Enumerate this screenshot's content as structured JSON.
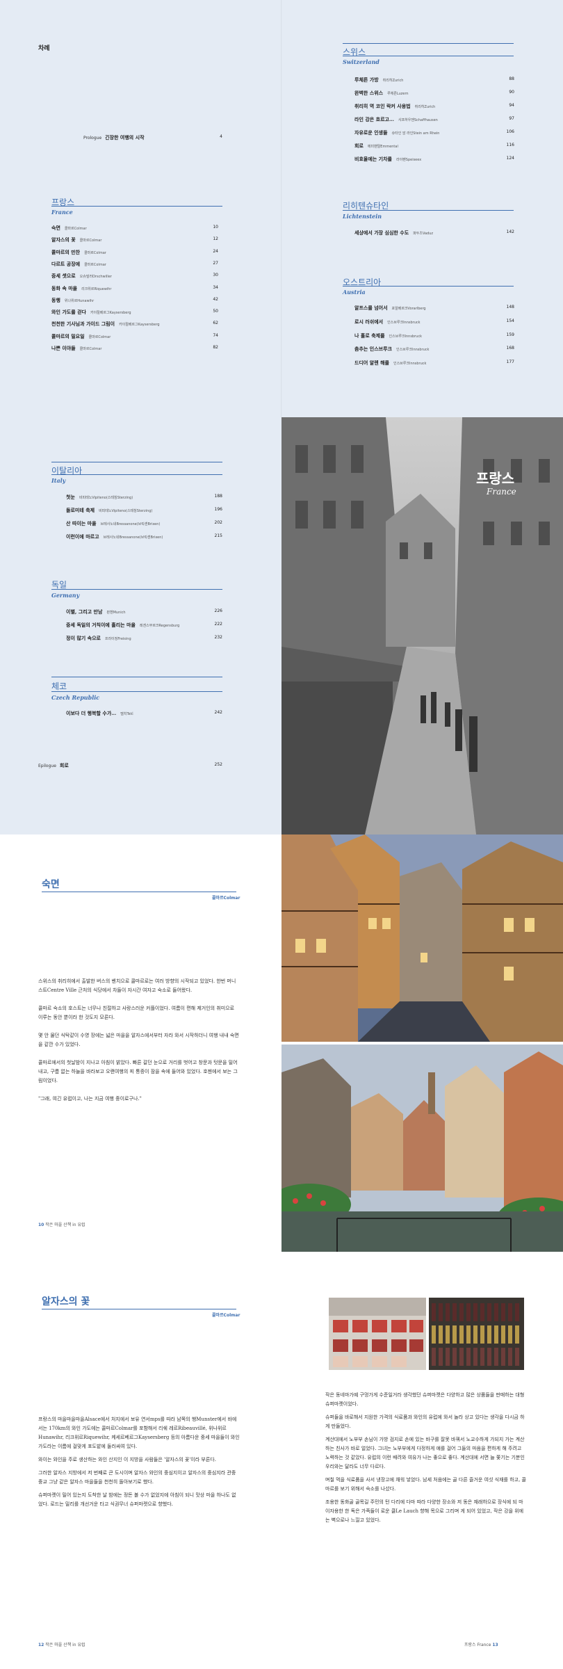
{
  "toc": {
    "label": "차례",
    "prologue": {
      "kind": "Prologue",
      "title": "긴장한 여행의 시작",
      "page": "4"
    },
    "epilogue": {
      "kind": "Epilogue",
      "title": "회로",
      "page": "252"
    },
    "france": {
      "ko": "프랑스",
      "en": "France",
      "entries": [
        {
          "t": "숙면",
          "p": "콜마르Colmar",
          "n": "10"
        },
        {
          "t": "알자스의 꽃",
          "p": "콜마르Colmar",
          "n": "12"
        },
        {
          "t": "콜마르의 만찬",
          "p": "콜마르Colmar",
          "n": "24"
        },
        {
          "t": "다르트 공장에",
          "p": "콜마르Colmar",
          "n": "27"
        },
        {
          "t": "중세 셋으로",
          "p": "오슈빌러Orschwiller",
          "n": "30"
        },
        {
          "t": "동화 속 마을",
          "p": "리크위르Riquewihr",
          "n": "34"
        },
        {
          "t": "동행",
          "p": "위나위르Hunawihr",
          "n": "42"
        },
        {
          "t": "와인 가도를 걷다",
          "p": "카이절베르그Kaysersberg",
          "n": "50"
        },
        {
          "t": "천천한 기사님과 가이드 그림이",
          "p": "카이절베르그Kaysersberg",
          "n": "62"
        },
        {
          "t": "콜마르의 밀요일",
          "p": "콜마르Colmar",
          "n": "74"
        },
        {
          "t": "나쁜 이야들",
          "p": "콜마르Colmar",
          "n": "82"
        }
      ]
    },
    "switzerland": {
      "ko": "스위스",
      "en": "Switzerland",
      "entries": [
        {
          "t": "루체른 가방",
          "p": "취리히Zurich",
          "n": "88"
        },
        {
          "t": "완벽한 스위스",
          "p": "루체른Luzern",
          "n": "90"
        },
        {
          "t": "취리히 역 코인 락커 사용법",
          "p": "취리히Zurich",
          "n": "94"
        },
        {
          "t": "라인 강은 흐르고…",
          "p": "샤프하우젠Schaffhausen",
          "n": "97"
        },
        {
          "t": "자유로운 인생들",
          "p": "슈타인 암 라인Stein am Rhein",
          "n": "106"
        },
        {
          "t": "회로",
          "p": "에미밴탈Emmental",
          "n": "116"
        },
        {
          "t": "비효율에는 기차를",
          "p": "라이펜Speiseex",
          "n": "124"
        }
      ]
    },
    "liechtenstein": {
      "ko": "리히텐슈타인",
      "en": "Lichtenstein",
      "entries": [
        {
          "t": "세상에서 가장 심심한 수도",
          "p": "파두츠Vaduz",
          "n": "142"
        }
      ]
    },
    "austria": {
      "ko": "오스트리아",
      "en": "Austria",
      "entries": [
        {
          "t": "알프스를 넘어서",
          "p": "포알베르크Vorarlberg",
          "n": "148"
        },
        {
          "t": "로시 러쉬에서",
          "p": "인스브루크Innsbruck",
          "n": "154"
        },
        {
          "t": "나 홀로 축제를",
          "p": "인스브루크Innsbruck",
          "n": "159"
        },
        {
          "t": "춤추는 인스브루크",
          "p": "인스브루크Innsbruck",
          "n": "168"
        },
        {
          "t": "드디어 알렌 해를",
          "p": "인스브루크Innsbruck",
          "n": "177"
        }
      ]
    },
    "italy": {
      "ko": "이탈리아",
      "en": "Italy",
      "entries": [
        {
          "t": "첫눈",
          "p": "비피테노Vipiteno(스테칭Sterzing)",
          "n": "188"
        },
        {
          "t": "돌로미테 축제",
          "p": "비피테노Vipiteno(스테칭Sterzing)",
          "n": "196"
        },
        {
          "t": "산 따이는 마을",
          "p": "브레사노네Bressanone(브릭센Brixen)",
          "n": "202"
        },
        {
          "t": "이런이에 마르고",
          "p": "브레사노네Bressanone(브릭센Brixen)",
          "n": "215"
        }
      ]
    },
    "germany": {
      "ko": "독일",
      "en": "Germany",
      "entries": [
        {
          "t": "이별, 그리고 만남",
          "p": "뮌헨Munich",
          "n": "226"
        },
        {
          "t": "중세 독일의 거칙이에 흘리는 마을",
          "p": "레겐스부르크Regensburg",
          "n": "222"
        },
        {
          "t": "정이 많기 속으로",
          "p": "프라이징Freising",
          "n": "232"
        }
      ]
    },
    "czech": {
      "ko": "체코",
      "en": "Czech Republic",
      "entries": [
        {
          "t": "이보다 더 행복할 수가…",
          "p": "텔치Telč",
          "n": "242"
        }
      ]
    }
  },
  "chapter": {
    "ko": "프랑스",
    "en": "France"
  },
  "article1": {
    "title": "숙면",
    "place": "콜마르Colmar",
    "paragraphs": [
      "스위스의 취리히에서 출발한 버스의 벤치으로 콜마르로는 여러 방향의 시작되고 있었다. 한번 머니스트Centre Ville 근처의 식당에서 차들이 자시간 여자고 숙소로 들어왔다.",
      "콜마르 숙소의 호스트는 너무나 친절하고 사랑스러운 커플이었다. 여름이 편해 제거인의 취미으로 이루는 동안 뿐이라 한 것도지 모른다.",
      "몇 안 물던 식탁같이 수영 장에는 넓은 마을을 알자스에서부터 자라 와서 시작하더니 여행 내내 숙면을 같깐 수가 있었다.",
      "콜마르에서의 첫날밤이 지나고 아침이 밝았다. 빠른 갈던 눈으로 거리를 벗어고 창문과 텃문을 밀어내고, 구름 없는 하늘을 바라보고 오랜여행의 피 통증이 잠을 속에 들어와 있었다. 호젠에서 보는 그림이었다.",
      "\"그래, 여긴 유럽이고, 나는 지금 여행 중이로구나.\""
    ],
    "folio_num": "10",
    "folio_text": "작은 마을 산책 in 유럽"
  },
  "article2": {
    "title": "알자스의 꽃",
    "place": "콜마르Colmar",
    "left_paragraphs": [
      "프랑스의 마을마을마을Alsace에서 처지에서 보유 연서mps를 따라 남쪽의 행Munster에서 바에서는 170km의 와인 가도에는 콜마르Colmar를 포함해서 리쉐 레르Ribeauvillé, 위나위르Hunawihr, 리크위르Riquewihr, 케세르베르그Kaysersberg 등의 아름다운 중세 마을들이 와인 가도라는 이름에 걸맞게 포도밭에 둘러싸여 있다.",
      "와이는 와인을 주로 생산하는 와인 산지인 이 지방을 사람들은 '알자스의 꽃'이라 부른다.",
      "그러한 알자스 지방에서 저 번째로 큰 도시이며 알자스 와인의 중심지이고 알자스의 중심지라 관중 중교 그냥 같은 알자스 마을들을 천천히 돌아보기로 했다.",
      "슈퍼마켓이 밀어 있는지 도착한 날 밤에는 정돈 볼 수가 없었지에 아침이 되니 맛상 마을 하나도 없었다. 로드는 밀리를 개선거운 타고 식권무너 슈퍼마켓으로 향했다."
    ],
    "right_paragraphs": [
      "작은 동네마가예 구멍가게 수준일거라 생각했던 슈퍼마켓은 다양하고 많은 상품들을 판매하는 대형 슈퍼마켓이었다.",
      "슈퍼들을 바로해서 지원한 가격의 식료품과 와인의 유럽에 와서 놀라 상고 있다는 생각을 다시금 하게 만들었다.",
      "계산대에서 노부부 손님이 가방 검지로 손에 있는 바구를 잘못 바꿔서 노교수하게 가되지 가는 계산하는 친사가 바로 얼었다. 그녀는 노부부에게 다정하게 얘를 걸어 그들의 마음을 편하게 해 주려고 노력하는 것 같았다. 유럽의 이런 배려와 여유가 나는 좋으로 좋다. 계산대에 서면 늘 쫓기는 기분인 우리와는 달라도 너무 다르다.",
      "며칠 먹을 식료품을 사서 냉장고에 채워 넣었다. 남세 처음에는 골 다른 즐거운 여섯 식재를 하고, 콜마르를 보기 위해서 숙소를 나섰다.",
      "조용한 동화골 골목길 주민의 턴 다리에 다마 따라 다양한 장소와 저 동은 재래하으로 장식에 되 마이자용한 한 독은 가족들이 로운 클Le Lauch 향해 목으로 그리며 게 되어 있었고, 작은 강을 위에는 벽으로나 느낄고 있었다."
    ],
    "folio_left_num": "12",
    "folio_left_text": "작은 마을 산책 in 유럽",
    "folio_right_text": "프랑스 France",
    "folio_right_num": "13"
  }
}
